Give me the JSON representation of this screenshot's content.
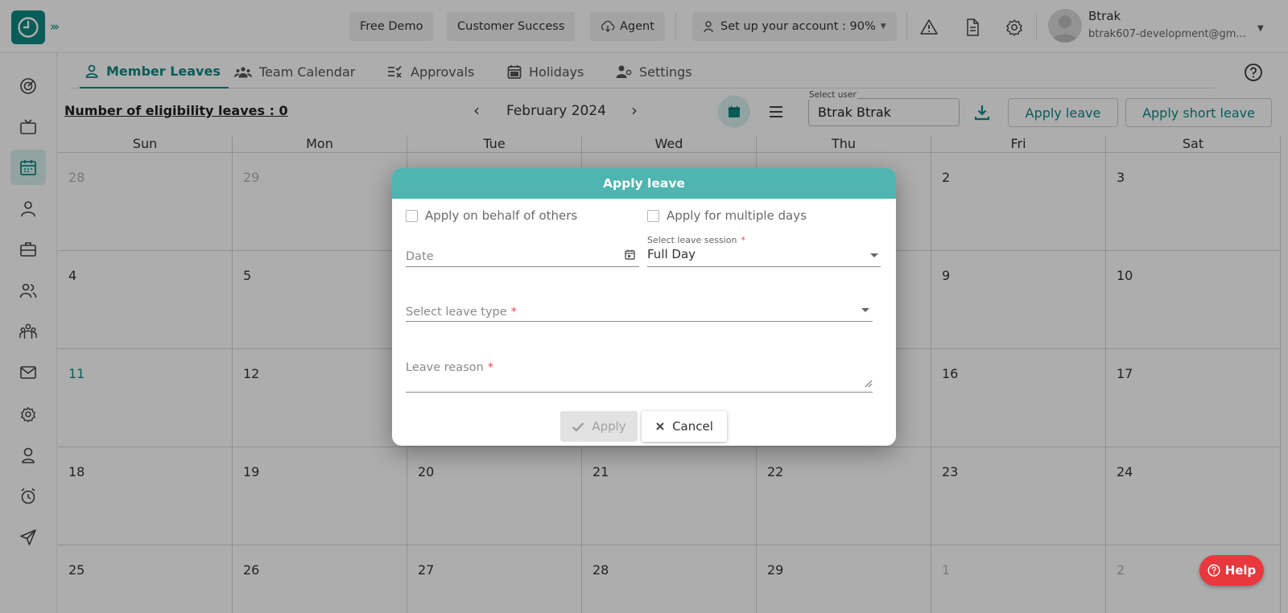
{
  "topbar": {
    "buttons": {
      "free_demo": "Free Demo",
      "customer_success": "Customer Success",
      "agent": "Agent"
    },
    "setup": "Set up your account : 90%",
    "user": {
      "name": "Btrak",
      "email": "btrak607-development@gm..."
    }
  },
  "tabs": [
    {
      "label": "Member Leaves",
      "icon": "person-icon",
      "active": true
    },
    {
      "label": "Team Calendar",
      "icon": "team-icon"
    },
    {
      "label": "Approvals",
      "icon": "approvals-icon"
    },
    {
      "label": "Holidays",
      "icon": "calendar-icon"
    },
    {
      "label": "Settings",
      "icon": "user-settings-icon"
    }
  ],
  "toolbar": {
    "eligibility": "Number of eligibility leaves : 0",
    "month": "February 2024",
    "select_user_label": "Select user",
    "select_user_value": "Btrak Btrak",
    "apply_leave": "Apply leave",
    "apply_short_leave": "Apply short leave"
  },
  "calendar": {
    "weekdays": [
      "Sun",
      "Mon",
      "Tue",
      "Wed",
      "Thu",
      "Fri",
      "Sat"
    ],
    "weeks": [
      [
        {
          "d": "28",
          "muted": true
        },
        {
          "d": "29",
          "muted": true
        },
        {
          "d": ""
        },
        {
          "d": ""
        },
        {
          "d": ""
        },
        {
          "d": "2"
        },
        {
          "d": "3"
        }
      ],
      [
        {
          "d": "4"
        },
        {
          "d": "5"
        },
        {
          "d": ""
        },
        {
          "d": ""
        },
        {
          "d": ""
        },
        {
          "d": "9"
        },
        {
          "d": "10"
        }
      ],
      [
        {
          "d": "11",
          "today": true
        },
        {
          "d": "12"
        },
        {
          "d": ""
        },
        {
          "d": ""
        },
        {
          "d": ""
        },
        {
          "d": "16"
        },
        {
          "d": "17"
        }
      ],
      [
        {
          "d": "18"
        },
        {
          "d": "19"
        },
        {
          "d": "20"
        },
        {
          "d": "21"
        },
        {
          "d": "22"
        },
        {
          "d": "23"
        },
        {
          "d": "24"
        }
      ],
      [
        {
          "d": "25"
        },
        {
          "d": "26"
        },
        {
          "d": "27"
        },
        {
          "d": "28"
        },
        {
          "d": "29"
        },
        {
          "d": "1",
          "muted": true
        },
        {
          "d": "2",
          "muted": true
        }
      ]
    ]
  },
  "dialog": {
    "title": "Apply leave",
    "apply_on_behalf": "Apply on behalf of others",
    "apply_multiple_days": "Apply for multiple days",
    "date_placeholder": "Date",
    "session_label": "Select leave session",
    "session_value": "Full Day",
    "leave_type_label": "Select leave type",
    "leave_reason_label": "Leave reason",
    "required_mark": "*",
    "apply_button": "Apply",
    "cancel_button": "Cancel"
  },
  "help_button": "Help",
  "colors": {
    "accent": "#0e8a82",
    "dialog_header": "#4eb5b0",
    "help": "#e8383d"
  }
}
